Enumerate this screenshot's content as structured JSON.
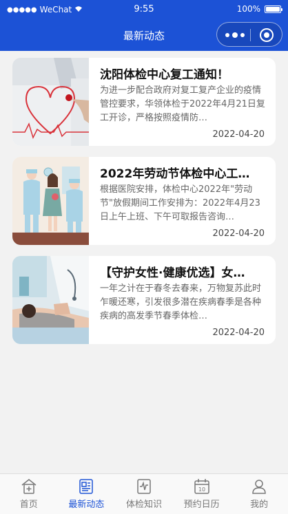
{
  "status_bar": {
    "signal": "●●●●●",
    "carrier": "WeChat",
    "time": "9:55",
    "battery": "100%"
  },
  "nav": {
    "title": "最新动态"
  },
  "articles": [
    {
      "title": "沈阳体检中心复工通知！",
      "desc": "为进一步配合政府对复工复产企业的疫情管控要求，华领体检于2022年4月21日复工开诊，严格按照疫情防…",
      "date": "2022-04-20",
      "thumb_icon": "heart-ecg-image"
    },
    {
      "title": "2022年劳动节体检中心工…",
      "desc": "根据医院安排，体检中心2022年\"劳动节\"放假期间工作安排为：2022年4月23日上午上班、下午可取报告咨询…",
      "date": "2022-04-20",
      "thumb_icon": "doctors-patient-image"
    },
    {
      "title": "【守护女性·健康优选】女…",
      "desc": "一年之计在于春冬去春来，万物复苏此时乍暖还寒，引发很多潜在疾病春季是各种疾病的高发季节春季体检…",
      "date": "2022-04-20",
      "thumb_icon": "woman-exam-image"
    }
  ],
  "tabs": [
    {
      "label": "首页",
      "icon": "home-medical-icon",
      "active": false
    },
    {
      "label": "最新动态",
      "icon": "news-icon",
      "active": true
    },
    {
      "label": "体检知识",
      "icon": "ecg-board-icon",
      "active": false
    },
    {
      "label": "预约日历",
      "icon": "calendar-icon",
      "active": false
    },
    {
      "label": "我的",
      "icon": "user-icon",
      "active": false
    }
  ],
  "colors": {
    "brand": "#1c52d6",
    "background": "#f2f2f2",
    "tab_inactive": "#777777"
  }
}
